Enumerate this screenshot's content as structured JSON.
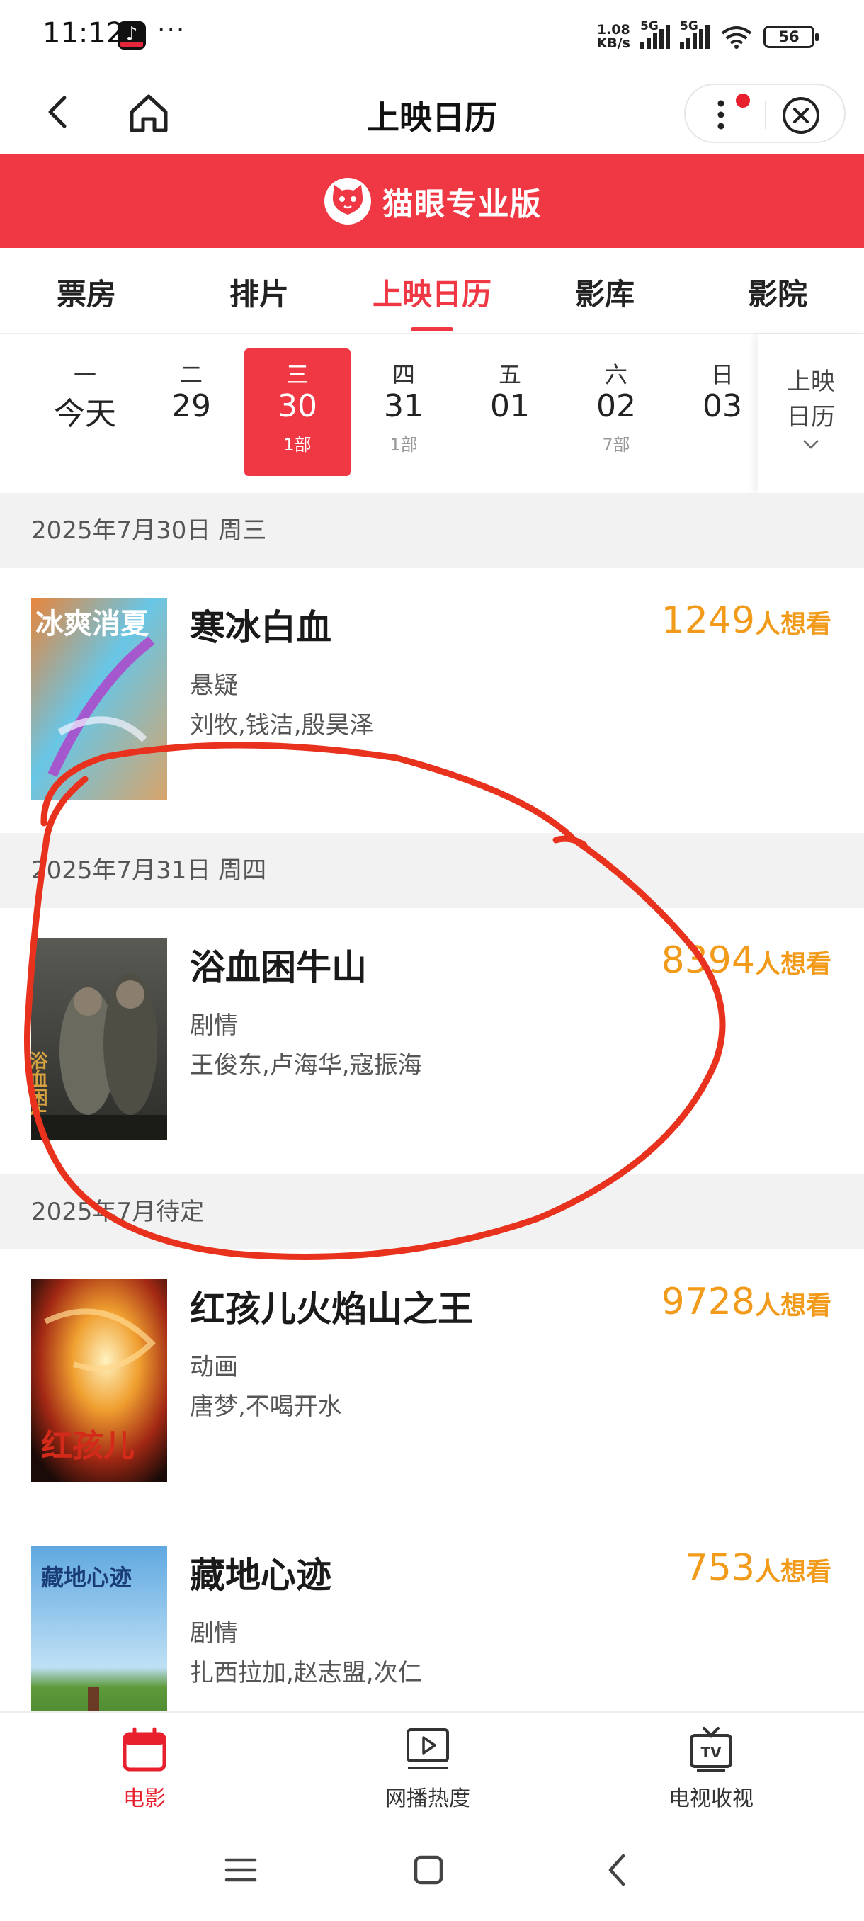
{
  "status_bar": {
    "time": "11:12",
    "app_icon": "douyin-icon",
    "more": "···",
    "speed_top": "1.08",
    "speed_bottom": "KB/s",
    "sig1": "5G",
    "sig2": "5G",
    "battery": "56"
  },
  "nav": {
    "title": "上映日历",
    "back_icon": "chevron-left-icon",
    "home_icon": "home-icon",
    "more_icon": "more-vertical-icon",
    "close_icon": "close-circle-icon"
  },
  "brand": {
    "name": "猫眼专业版",
    "logo_icon": "cat-logo-icon",
    "color": "#f03844"
  },
  "tabs": [
    {
      "label": "票房"
    },
    {
      "label": "排片"
    },
    {
      "label": "上映日历",
      "active": true
    },
    {
      "label": "影库"
    },
    {
      "label": "影院"
    }
  ],
  "dates": [
    {
      "weekday": "一",
      "day": "今天",
      "count": ""
    },
    {
      "weekday": "二",
      "day": "29",
      "count": ""
    },
    {
      "weekday": "三",
      "day": "30",
      "count": "1部",
      "active": true
    },
    {
      "weekday": "四",
      "day": "31",
      "count": "1部"
    },
    {
      "weekday": "五",
      "day": "01",
      "count": ""
    },
    {
      "weekday": "六",
      "day": "02",
      "count": "7部"
    },
    {
      "weekday": "日",
      "day": "03",
      "count": ""
    }
  ],
  "calendar_button": {
    "line1": "上映",
    "line2": "日历"
  },
  "sections": [
    {
      "header": "2025年7月30日 周三"
    },
    {
      "header": "2025年7月31日 周四"
    },
    {
      "header": "2025年7月待定"
    }
  ],
  "movies": [
    {
      "title": "寒冰白血",
      "genre": "悬疑",
      "cast": "刘牧,钱洁,殷昊泽",
      "want_count": "1249",
      "want_label": "人想看",
      "poster_text": "冰爽消夏"
    },
    {
      "title": "浴血困牛山",
      "genre": "剧情",
      "cast": "王俊东,卢海华,寇振海",
      "want_count": "8394",
      "want_label": "人想看",
      "poster_text": "浴血困牛山"
    },
    {
      "title": "红孩儿火焰山之王",
      "genre": "动画",
      "cast": "唐梦,不喝开水",
      "want_count": "9728",
      "want_label": "人想看",
      "poster_text": "红孩儿"
    },
    {
      "title": "藏地心迹",
      "genre": "剧情",
      "cast": "扎西拉加,赵志盟,次仁",
      "want_count": "753",
      "want_label": "人想看",
      "poster_text": "藏地心迹"
    }
  ],
  "bottom_tabs": [
    {
      "label": "电影",
      "icon": "calendar-icon",
      "active": true
    },
    {
      "label": "网播热度",
      "icon": "play-screen-icon"
    },
    {
      "label": "电视收视",
      "icon": "tv-icon"
    }
  ],
  "colors": {
    "accent": "#f03844",
    "want": "#f29a1a",
    "annotation": "#e8321e"
  }
}
